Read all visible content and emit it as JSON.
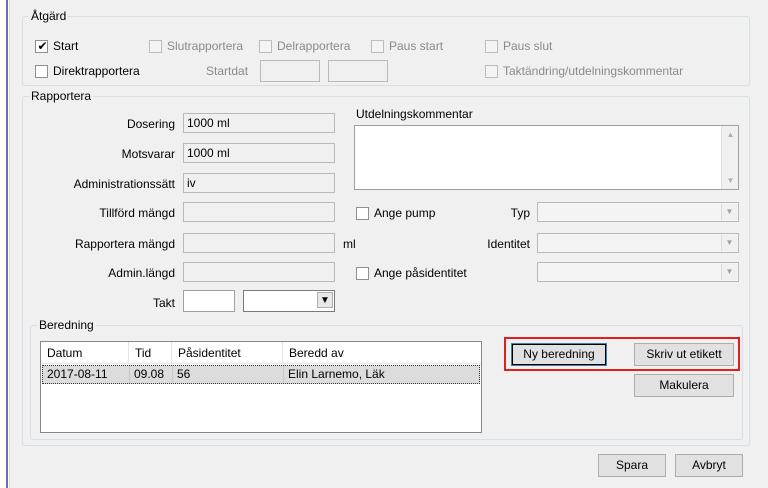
{
  "atgard": {
    "label": "Åtgärd",
    "start": {
      "label": "Start",
      "checked": true
    },
    "slutrapportera": "Slutrapportera",
    "delrapportera": "Delrapportera",
    "paus_start": "Paus start",
    "paus_slut": "Paus slut",
    "direktrapportera": "Direktrapportera",
    "startdat": "Startdat",
    "taktandring": "Taktändring/utdelningskommentar"
  },
  "rapportera": {
    "label": "Rapportera",
    "dosering": {
      "label": "Dosering",
      "value": "1000 ml"
    },
    "motsvarar": {
      "label": "Motsvarar",
      "value": "1000 ml"
    },
    "administrationssatt": {
      "label": "Administrationssätt",
      "value": "iv"
    },
    "tillford_mangd": {
      "label": "Tillförd mängd",
      "value": ""
    },
    "rapportera_mangd": {
      "label": "Rapportera mängd",
      "value": "",
      "unit": "ml"
    },
    "admin_langd": {
      "label": "Admin.längd",
      "value": ""
    },
    "takt": {
      "label": "Takt",
      "value": ""
    },
    "utdelningskommentar": {
      "label": "Utdelningskommentar",
      "value": ""
    },
    "ange_pump": "Ange pump",
    "typ": "Typ",
    "identitet": "Identitet",
    "ange_pasidentitet": "Ange påsidentitet"
  },
  "beredning": {
    "label": "Beredning",
    "columns": [
      "Datum",
      "Tid",
      "Påsidentitet",
      "Beredd av"
    ],
    "rows": [
      [
        "2017-08-11",
        "09.08",
        "56",
        "Elin Larnemo, Läk"
      ]
    ],
    "ny_beredning": "Ny beredning",
    "skriv_ut_etikett": "Skriv ut etikett",
    "makulera": "Makulera"
  },
  "footer": {
    "spara": "Spara",
    "avbryt": "Avbryt"
  },
  "colors": {
    "highlight": "#e02020",
    "window_bg": "#f0f0f0"
  }
}
